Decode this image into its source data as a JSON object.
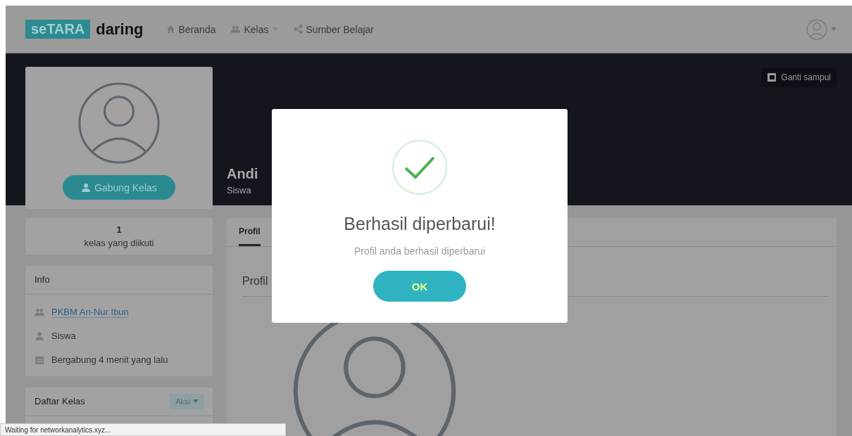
{
  "navbar": {
    "logo": {
      "boxed": "seTARA",
      "rest": "daring"
    },
    "items": [
      {
        "kind": "home",
        "label": "Beranda",
        "dropdown": false
      },
      {
        "kind": "group",
        "label": "Kelas",
        "dropdown": true
      },
      {
        "kind": "share",
        "label": "Sumber Belajar",
        "dropdown": false
      }
    ]
  },
  "cover": {
    "change_button": "Ganti sampul",
    "name": "Andi",
    "role": "Siswa"
  },
  "profile_card": {
    "join_button": "Gabung Kelas"
  },
  "stats": {
    "count": "1",
    "label": "kelas yang diikuti"
  },
  "info": {
    "title": "Info",
    "items": [
      {
        "kind": "group",
        "text": "PKBM An-Nur Ibun",
        "link": true
      },
      {
        "kind": "user",
        "text": "Siswa",
        "link": false
      },
      {
        "kind": "calendar",
        "text": "Bergabung 4 menit yang lalu",
        "link": false
      }
    ]
  },
  "class_list": {
    "title": "Daftar Kelas",
    "action_button": "Aksi"
  },
  "main": {
    "tabs": [
      {
        "label": "Profil",
        "selected": true
      }
    ],
    "heading": "Profil"
  },
  "dialog": {
    "title": "Berhasil diperbarui!",
    "message": "Profil anda berhasil diperbarui",
    "button": "OK"
  },
  "status_bar": "Waiting for networkanalytics.xyz..."
}
